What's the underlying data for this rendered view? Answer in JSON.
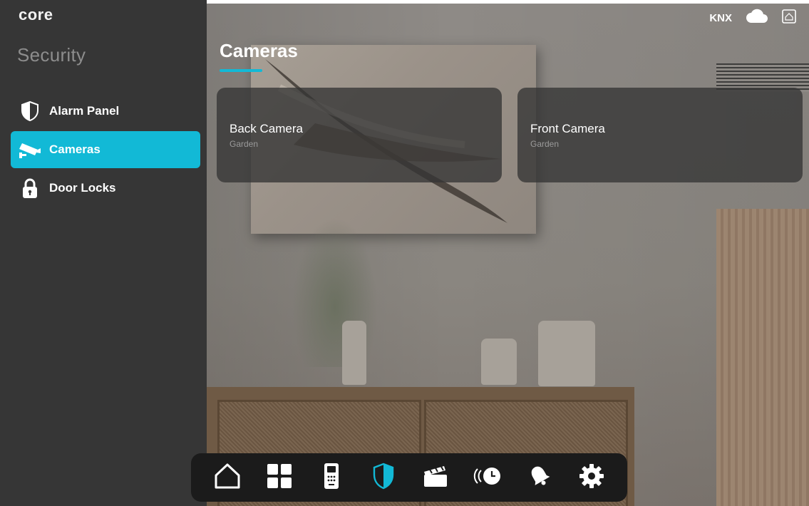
{
  "app": {
    "logo": "core",
    "section_title": "Security"
  },
  "status_bar": {
    "protocol_label": "KNX",
    "icons": [
      "cloud-icon",
      "gateway-icon"
    ]
  },
  "sidebar": {
    "items": [
      {
        "label": "Alarm Panel",
        "icon": "shield-icon",
        "active": false
      },
      {
        "label": "Cameras",
        "icon": "camera-icon",
        "active": true
      },
      {
        "label": "Door Locks",
        "icon": "lock-icon",
        "active": false
      }
    ]
  },
  "main": {
    "title": "Cameras",
    "cameras": [
      {
        "name": "Back Camera",
        "location": "Garden"
      },
      {
        "name": "Front Camera",
        "location": "Garden"
      }
    ]
  },
  "dock": {
    "items": [
      {
        "icon": "home-icon",
        "active": false
      },
      {
        "icon": "grid-icon",
        "active": false
      },
      {
        "icon": "intercom-icon",
        "active": false
      },
      {
        "icon": "shield-icon",
        "active": true
      },
      {
        "icon": "scenes-icon",
        "active": false
      },
      {
        "icon": "schedule-icon",
        "active": false
      },
      {
        "icon": "notifications-icon",
        "active": false
      },
      {
        "icon": "settings-icon",
        "active": false
      }
    ]
  },
  "colors": {
    "accent": "#12b9d6",
    "sidebar_bg": "#363636",
    "dock_bg": "#1b1b1b"
  }
}
